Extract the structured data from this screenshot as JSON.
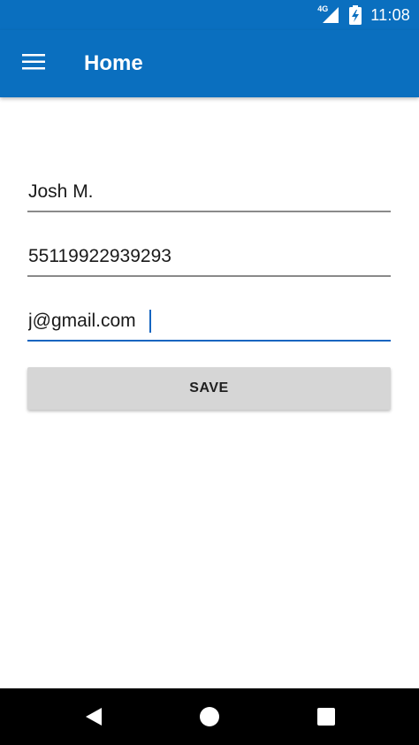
{
  "status_bar": {
    "network_type": "4G",
    "time": "11:08",
    "icons": [
      "signal-icon",
      "battery-charging-icon"
    ]
  },
  "app_bar": {
    "title": "Home",
    "menu_icon": "hamburger-menu-icon"
  },
  "form": {
    "name_value": "Josh M.",
    "phone_value": "55119922939293",
    "email_value": "j@gmail.com",
    "save_label": "SAVE"
  },
  "nav_bar": {
    "icons": [
      "back-icon",
      "home-icon",
      "recents-icon"
    ]
  },
  "colors": {
    "primary": "#0a6fbf",
    "accent": "#1565c0",
    "button": "#d6d6d6",
    "field_line": "#8a8a8a"
  }
}
